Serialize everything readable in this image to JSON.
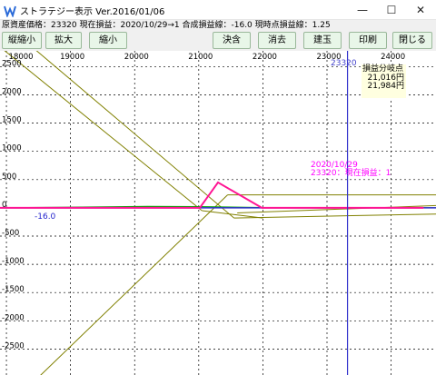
{
  "window": {
    "title": "ストラテジー表示 Ver.2016/01/06",
    "controls": {
      "minimize": "—",
      "maximize": "☐",
      "close": "✕"
    }
  },
  "status": {
    "text": "原資産価格：23320 現在損益：2020/10/29→1 合成損益線：-16.0 現時点損益線：1.25"
  },
  "toolbar": {
    "buttons": [
      {
        "id": "zoom-vertical",
        "label": "縦縮小"
      },
      {
        "id": "zoom-in",
        "label": "拡大"
      },
      {
        "id": "zoom-out",
        "label": "縮小"
      },
      {
        "id": "settle",
        "label": "決含"
      },
      {
        "id": "delete",
        "label": "消去"
      },
      {
        "id": "build",
        "label": "建玉"
      },
      {
        "id": "print",
        "label": "印刷"
      },
      {
        "id": "close",
        "label": "閉じる"
      }
    ]
  },
  "chart": {
    "colors": {
      "grid": "#000000",
      "composite": "#808000",
      "current": "#ff1493",
      "price_line": "#3333cc",
      "green": "#00a000"
    },
    "x_ticks": [
      "18000",
      "19000",
      "20000",
      "21000",
      "22000",
      "23000",
      "24000"
    ],
    "y_ticks": [
      "2500",
      "2000",
      "1500",
      "1000",
      "500",
      "0",
      "-500",
      "-1000",
      "-1500",
      "-2000",
      "-2500"
    ],
    "current_price_label": "23320",
    "zero_value_label": "-16.0",
    "breakeven": {
      "title": "損益分岐点",
      "values": [
        "21,016円",
        "21,984円"
      ]
    },
    "note": {
      "date": "2020/10/29",
      "text": "23320：現在損益：1"
    }
  },
  "chart_data": {
    "type": "line",
    "x": [
      17000,
      21016,
      21300,
      21984,
      24500
    ],
    "series": [
      {
        "name": "現時点損益線",
        "values": [
          0,
          0,
          450,
          0,
          0
        ]
      }
    ],
    "xlim": [
      17900,
      24700
    ],
    "ylim": [
      -3000,
      2900
    ],
    "current_price": 23320,
    "grid": true
  }
}
